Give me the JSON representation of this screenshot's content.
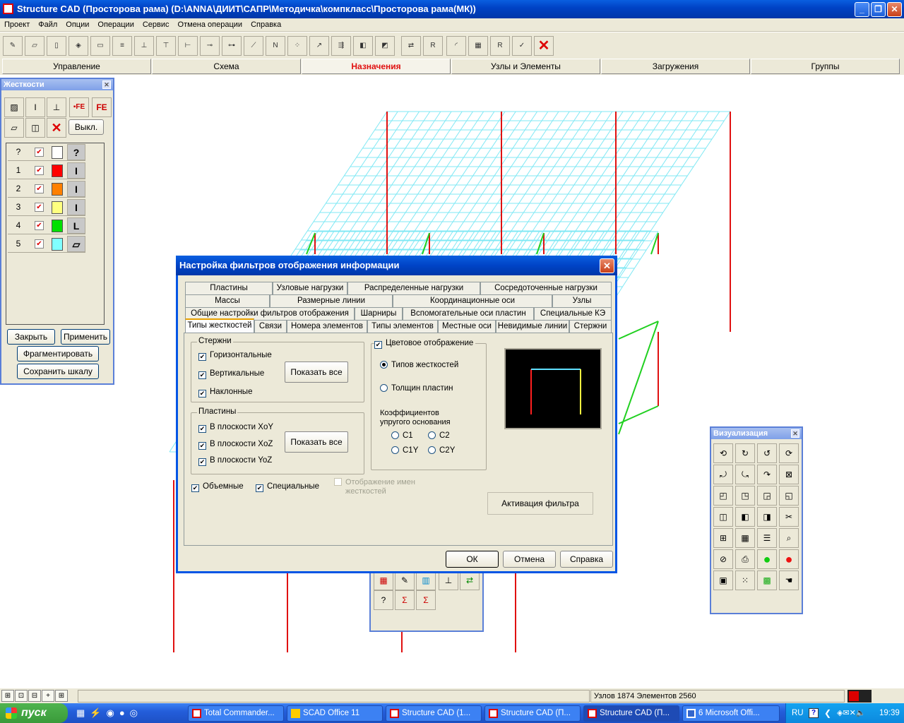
{
  "window": {
    "title": "Structure CAD (Просторова рама) (D:\\ANNA\\ДИИТ\\САПР\\Методичка\\компкласс\\Просторова рама(МК))",
    "min_label": "_",
    "max_label": "❐",
    "close_label": "✕"
  },
  "menu": [
    "Проект",
    "Файл",
    "Опции",
    "Операции",
    "Сервис",
    "Отмена операции",
    "Справка"
  ],
  "main_tabs": [
    "Управление",
    "Схема",
    "Назначения",
    "Узлы и Элементы",
    "Загружения",
    "Группы"
  ],
  "active_tab": "Назначения",
  "stiffness_panel": {
    "title": "Жесткости",
    "off_button": "Выкл.",
    "rows": [
      {
        "num": "?",
        "color": "#ffffff",
        "icon": "?"
      },
      {
        "num": "1",
        "color": "#ff0000",
        "icon": "I"
      },
      {
        "num": "2",
        "color": "#ff8000",
        "icon": "I"
      },
      {
        "num": "3",
        "color": "#ffff80",
        "icon": "I"
      },
      {
        "num": "4",
        "color": "#00e000",
        "icon": "L"
      },
      {
        "num": "5",
        "color": "#80ffff",
        "icon": "▱"
      }
    ],
    "close_btn": "Закрыть",
    "apply_btn": "Применить",
    "fragment_btn": "Фрагментировать",
    "save_btn": "Сохранить шкалу"
  },
  "dialog": {
    "title": "Настройка фильтров отображения информации",
    "tabs_row1": [
      "Пластины",
      "Узловые нагрузки",
      "Распределенные нагрузки",
      "Сосредоточенные нагрузки"
    ],
    "tabs_row2": [
      "Массы",
      "Размерные линии",
      "Координационные оси",
      "Узлы"
    ],
    "tabs_row3": [
      "Общие настройки фильтров отображения",
      "Шарниры",
      "Вспомогательные оси пластин",
      "Специальные КЭ"
    ],
    "tabs_row4": [
      "Типы жесткостей",
      "Связи",
      "Номера элементов",
      "Типы элементов",
      "Местные оси",
      "Невидимые линии",
      "Стержни"
    ],
    "rods_group": "Стержни",
    "rods": [
      "Горизонтальные",
      "Вертикальные",
      "Наклонные"
    ],
    "show_all": "Показать все",
    "plates_group": "Пластины",
    "plates": [
      "В плоскости XoY",
      "В плоскости XoZ",
      "В плоскости YoZ"
    ],
    "color_display": "Цветовое отображение",
    "radio_types": "Типов жесткостей",
    "radio_thickness": "Толщин пластин",
    "coef_label_1": "Коэффициентов",
    "coef_label_2": "упругого основания",
    "coefs": [
      "C1",
      "C2",
      "C1Y",
      "C2Y"
    ],
    "volumetric": "Объемные",
    "special": "Специальные",
    "names_display_1": "Отображение имен",
    "names_display_2": "жесткостей",
    "activate_filter": "Активация фильтра",
    "ok": "ОК",
    "cancel": "Отмена",
    "help": "Справка"
  },
  "viz_panel": {
    "title": "Визуализация"
  },
  "status": {
    "counts": "Узлов 1874 Элементов 2560"
  },
  "taskbar": {
    "start": "пуск",
    "tasks": [
      "Total Commander...",
      "SCAD Office 11",
      "Structure CAD (1...",
      "Structure CAD (П...",
      "Structure CAD (П...",
      "6 Microsoft Offi..."
    ],
    "lang": "RU",
    "clock": "19:39"
  },
  "colors": {
    "grid_cyan": "#7fe8f4",
    "column_red": "#e01010",
    "brace_green": "#20d020",
    "preview_cyan": "#60e0ff",
    "preview_red": "#ff2020",
    "preview_yellow": "#ffff40"
  }
}
